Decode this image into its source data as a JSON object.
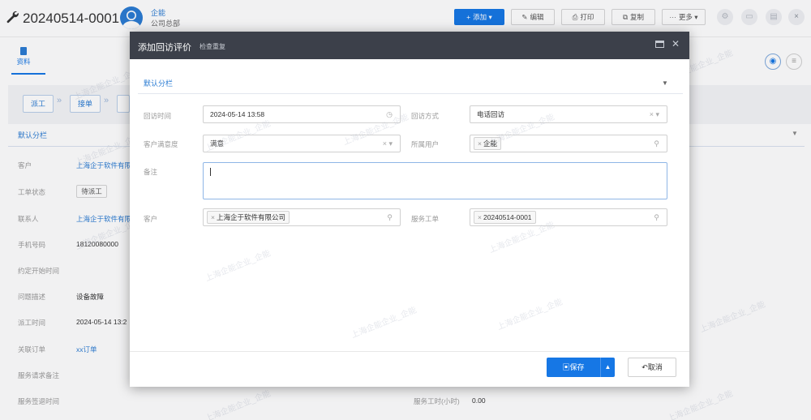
{
  "record": {
    "number": "20240514-0001",
    "user_name": "企能",
    "user_org": "公司总部"
  },
  "toolbar": {
    "add_label": "添加",
    "edit_label": "编辑",
    "print_label": "打印",
    "copy_label": "复制",
    "more_label": "更多",
    "accent": "#1677e5"
  },
  "tabs": [
    {
      "label": "资料",
      "active": true
    }
  ],
  "flow": {
    "steps": [
      "派工",
      "接单"
    ]
  },
  "section": {
    "title": "默认分栏"
  },
  "fields": [
    {
      "label": "客户",
      "value": "上海企于软件有限"
    },
    {
      "label": "工单状态",
      "value": "待派工"
    },
    {
      "label": "联系人",
      "value": "上海企于软件有限"
    },
    {
      "label": "手机号码",
      "value": "18120080000"
    },
    {
      "label": "约定开始时间",
      "value": ""
    },
    {
      "label": "问题描述",
      "value": "设备故障"
    },
    {
      "label": "派工时间",
      "value": "2024-05-14 13:2"
    },
    {
      "label": "关联订单",
      "value": "xx订单"
    },
    {
      "label": "服务请求备注",
      "value": ""
    },
    {
      "label": "服务签退时间",
      "value": ""
    }
  ],
  "work_hours": {
    "label": "服务工时(小时)",
    "value": "0.00"
  },
  "modal": {
    "title": "添加回访评价",
    "subtitle": "检查重复",
    "section_title": "默认分栏",
    "visit_time_label": "回访时间",
    "visit_time_value": "2024-05-14 13:58",
    "visit_method_label": "回访方式",
    "visit_method_value": "电话回访",
    "satisfaction_label": "客户满意度",
    "satisfaction_value": "满意",
    "owner_label": "所属用户",
    "owner_tag": "企能",
    "remark_label": "备注",
    "remark_value": "",
    "customer_label": "客户",
    "customer_tag": "上海企于软件有限公司",
    "ticket_label": "服务工单",
    "ticket_tag": "20240514-0001",
    "save_label": "保存",
    "cancel_label": "取消"
  },
  "watermark": "上海企能企业_企能"
}
